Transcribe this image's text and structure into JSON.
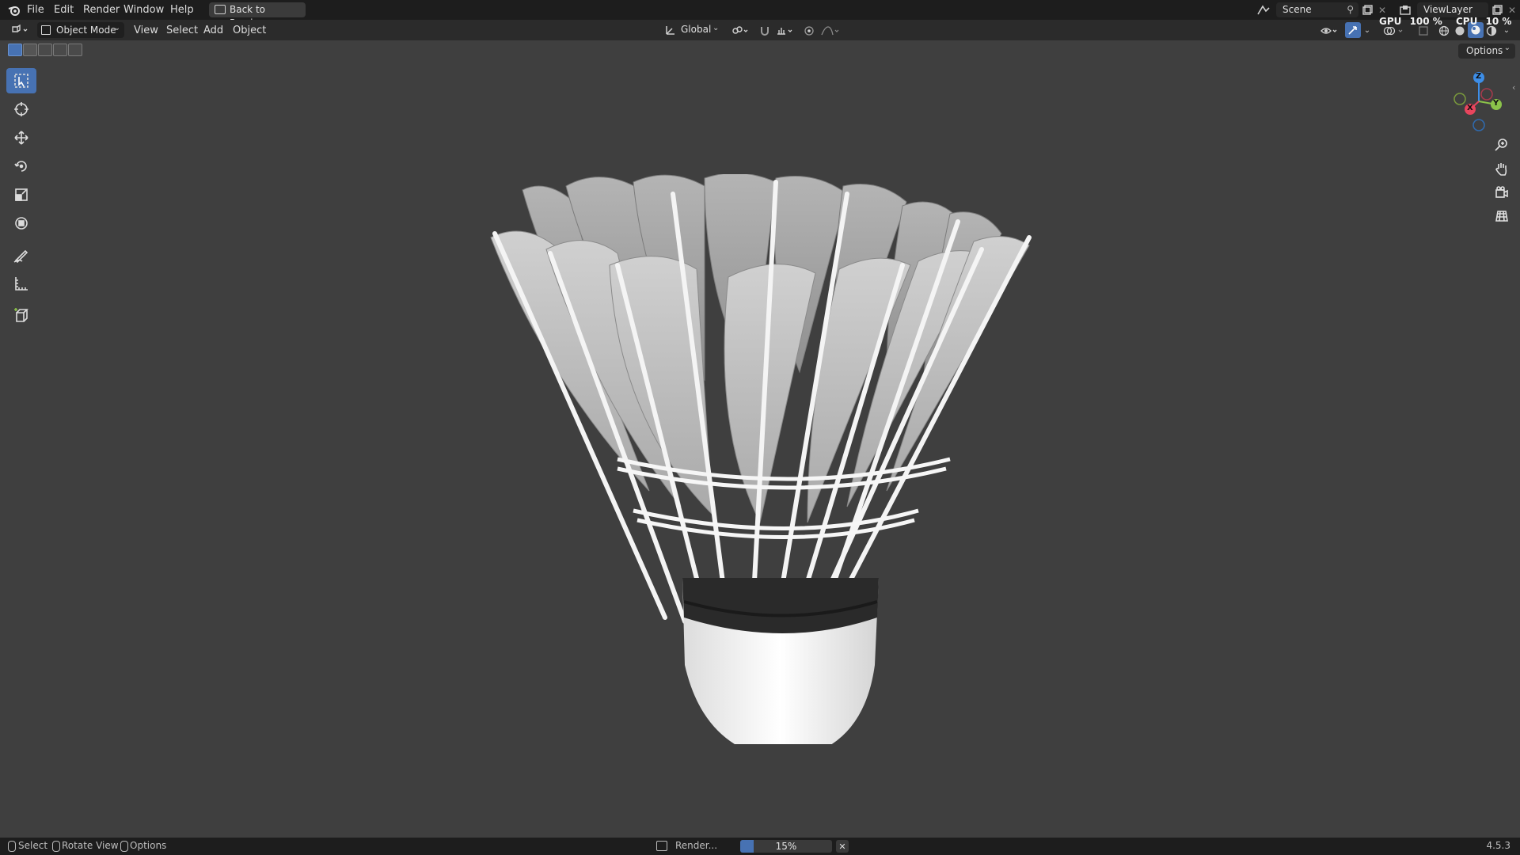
{
  "topbar": {
    "menus": [
      "File",
      "Edit",
      "Render",
      "Window",
      "Help"
    ],
    "back_button": "Back to Previous",
    "scene_label": "Scene",
    "viewlayer_label": "ViewLayer",
    "gpu": "GPU",
    "gpu_value": "100 %",
    "cpu": "CPU",
    "cpu_value": "10 %"
  },
  "header": {
    "mode": "Object Mode",
    "menus": [
      "View",
      "Select",
      "Add",
      "Object"
    ],
    "transform_orientation": "Global",
    "options_label": "Options"
  },
  "gizmo": {
    "z": "Z",
    "y": "Y",
    "x": "X"
  },
  "status": {
    "select": "Select",
    "rotate": "Rotate View",
    "options": "Options",
    "render_label": "Render...",
    "progress_text": "15%",
    "progress": 0.15,
    "version": "4.5.3"
  },
  "colors": {
    "accent": "#4772b3",
    "x_axis": "#e8455d",
    "y_axis": "#8bc34a",
    "z_axis": "#3d8ee8"
  }
}
